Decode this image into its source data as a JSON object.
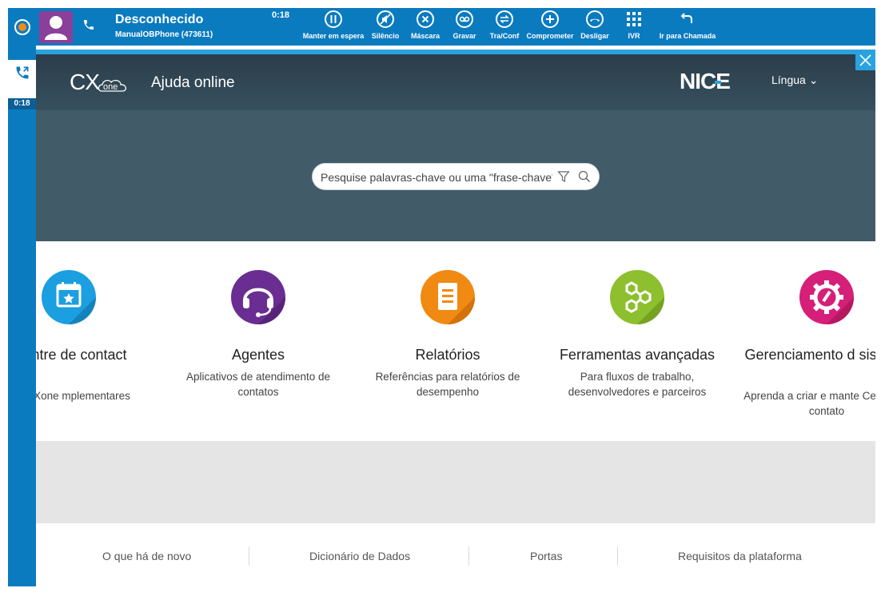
{
  "callbar": {
    "caller_name": "Desconhecido",
    "caller_sub": "ManualOBPhone (473611)",
    "timer": "0:18",
    "controls": [
      {
        "label": "Manter em espera",
        "icon": "pause-icon"
      },
      {
        "label": "Silêncio",
        "icon": "mute-icon"
      },
      {
        "label": "Máscara",
        "icon": "mask-icon"
      },
      {
        "label": "Gravar",
        "icon": "record-icon"
      },
      {
        "label": "Tra/Conf",
        "icon": "transfer-icon"
      },
      {
        "label": "Comprometer",
        "icon": "commit-icon"
      },
      {
        "label": "Desligar",
        "icon": "hangup-icon"
      },
      {
        "label": "IVR",
        "icon": "keypad-icon"
      },
      {
        "label": "Ir para Chamada",
        "icon": "go-to-call-icon"
      }
    ]
  },
  "leftstrip": {
    "timer": "0:18"
  },
  "header": {
    "logo_cx": "CX",
    "logo_one": "one",
    "title": "Ajuda online",
    "brand": "NICE",
    "language": "Língua ⌄"
  },
  "search": {
    "placeholder": "Pesquise palavras-chave ou uma \"frase-chave\""
  },
  "cards": [
    {
      "title": "s du Centre de contact",
      "desc": "plicativos CXone mplementares",
      "icon": "calendar-star-icon",
      "color": "#1b9fe0"
    },
    {
      "title": "Agentes",
      "desc": "Aplicativos de atendimento de contatos",
      "icon": "headset-icon",
      "color": "#6a2d91"
    },
    {
      "title": "Relatórios",
      "desc": "Referências para relatórios de desempenho",
      "icon": "report-icon",
      "color": "#f08a12"
    },
    {
      "title": "Ferramentas avançadas",
      "desc": "Para fluxos de trabalho, desenvolvedores e parceiros",
      "icon": "hex-tools-icon",
      "color": "#8dbf2e"
    },
    {
      "title": "Gerenciamento d sistema",
      "desc": "Aprenda a criar e mante Centro de contato",
      "icon": "gear-wrench-icon",
      "color": "#d61f78"
    }
  ],
  "footer": {
    "links": [
      "O que há de novo",
      "Dicionário de Dados",
      "Portas",
      "Requisitos da plataforma"
    ]
  }
}
